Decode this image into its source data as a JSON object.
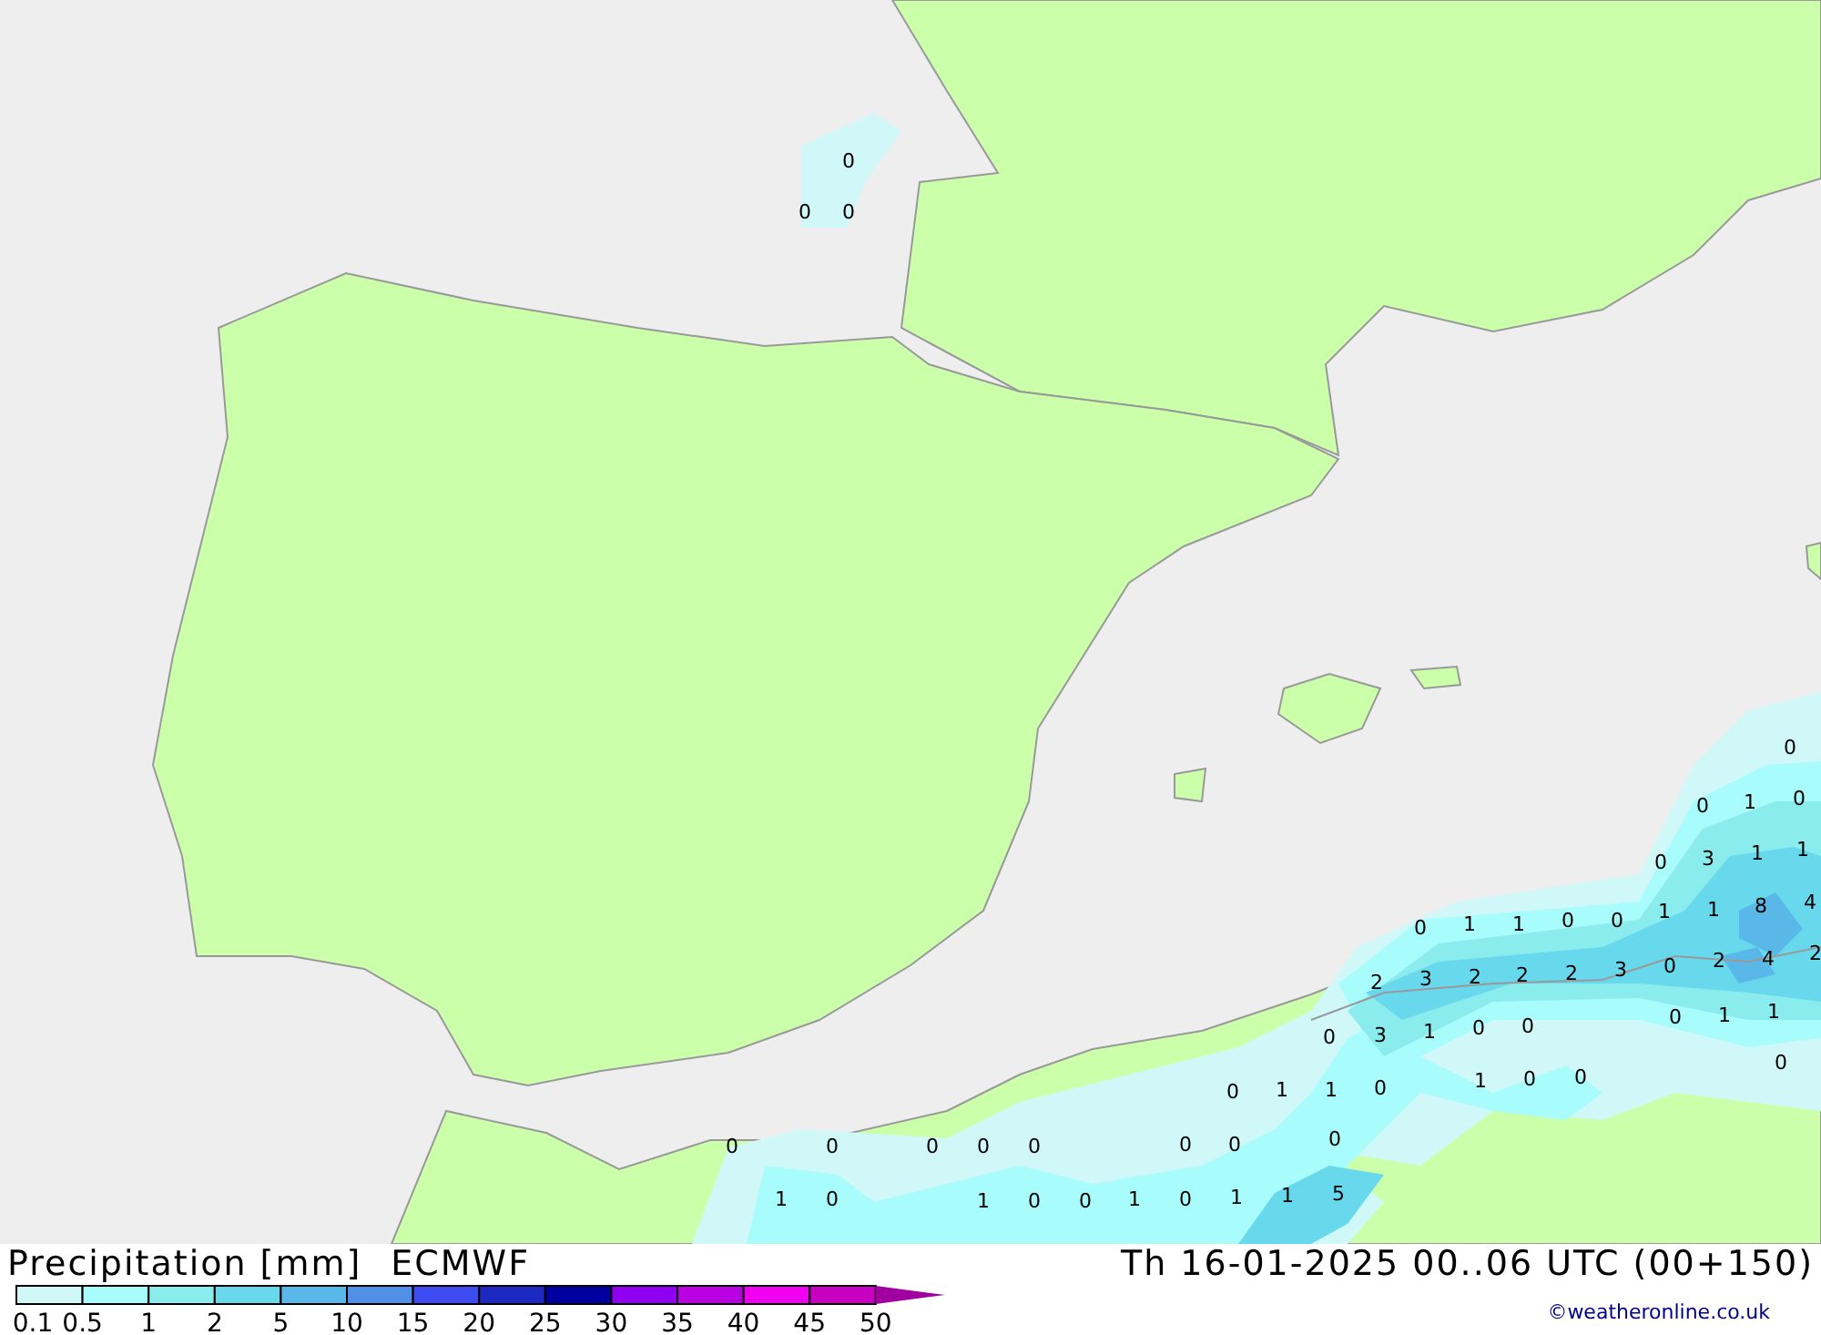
{
  "map": {
    "values": [
      "0",
      "0",
      "0",
      "0",
      "0",
      "1",
      "0",
      "0",
      "3",
      "1",
      "1",
      "8",
      "4",
      "0",
      "1",
      "1",
      "0",
      "0",
      "1",
      "1",
      "2",
      "3",
      "2",
      "2",
      "2",
      "3",
      "0",
      "2",
      "4",
      "2",
      "0",
      "3",
      "1",
      "0",
      "0",
      "0",
      "1",
      "1",
      "0",
      "0",
      "1",
      "1",
      "0",
      "1",
      "0",
      "0",
      "0",
      "0",
      "0",
      "0",
      "0",
      "0",
      "0",
      "0",
      "1",
      "0",
      "1",
      "0",
      "0",
      "1",
      "0",
      "1",
      "1",
      "5"
    ]
  },
  "legend": {
    "title": "Precipitation [mm]",
    "model": "ECMWF",
    "bins": [
      {
        "color": "#d0f8f8"
      },
      {
        "color": "#a8fcfc"
      },
      {
        "color": "#8aecec"
      },
      {
        "color": "#68d8ec"
      },
      {
        "color": "#5ab8e8"
      },
      {
        "color": "#5090e8"
      },
      {
        "color": "#3c4cf0"
      },
      {
        "color": "#1c28c0"
      },
      {
        "color": "#0000a0"
      },
      {
        "color": "#9000f0"
      },
      {
        "color": "#b800e0"
      },
      {
        "color": "#f000f0"
      },
      {
        "color": "#c800c0"
      },
      {
        "color": "#a000a0"
      }
    ],
    "ticks": [
      "0.1",
      "0.5",
      "1",
      "2",
      "5",
      "10",
      "15",
      "20",
      "25",
      "30",
      "35",
      "40",
      "45",
      "50"
    ]
  },
  "valid_time": "Th 16-01-2025 00..06 UTC (00+150)",
  "credit": "©weatheronline.co.uk"
}
